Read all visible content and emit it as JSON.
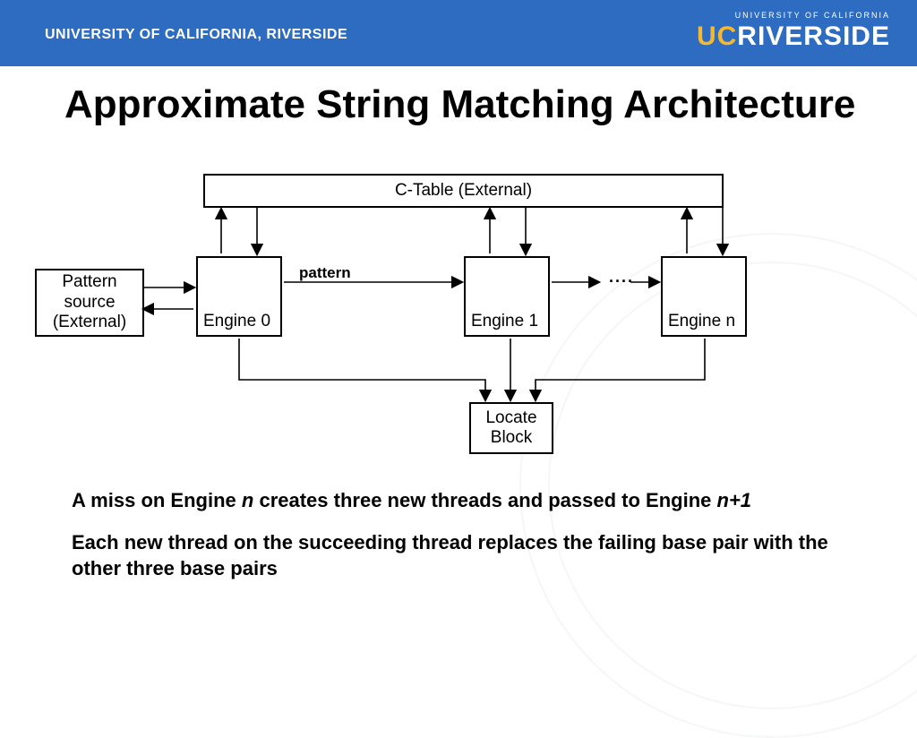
{
  "header": {
    "left_text": "UNIVERSITY OF CALIFORNIA, RIVERSIDE",
    "logo_top": "UNIVERSITY OF CALIFORNIA",
    "logo_uc": "UC",
    "logo_rest": "RIVERSIDE"
  },
  "title": "Approximate String Matching Architecture",
  "diagram": {
    "ctable": "C-Table (External)",
    "pattern_source": "Pattern source (External)",
    "engine0": "Engine 0",
    "engine1": "Engine 1",
    "enginen": "Engine n",
    "pattern_label": "pattern",
    "dots": "....",
    "locate": "Locate Block"
  },
  "bullets": {
    "b1_pre": "A miss on Engine ",
    "b1_n": "n",
    "b1_mid": " creates three new threads and passed to Engine ",
    "b1_np1": "n+1",
    "b2": "Each new thread on the succeeding thread replaces the failing base pair with the other three base pairs"
  }
}
